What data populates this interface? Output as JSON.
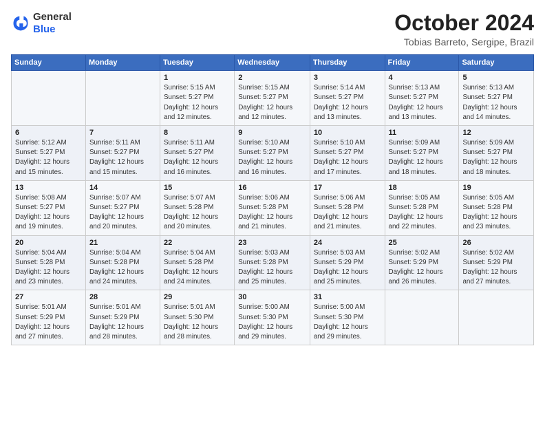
{
  "header": {
    "logo_general": "General",
    "logo_blue": "Blue",
    "month_title": "October 2024",
    "location": "Tobias Barreto, Sergipe, Brazil"
  },
  "weekdays": [
    "Sunday",
    "Monday",
    "Tuesday",
    "Wednesday",
    "Thursday",
    "Friday",
    "Saturday"
  ],
  "weeks": [
    [
      {
        "day": "",
        "info": ""
      },
      {
        "day": "",
        "info": ""
      },
      {
        "day": "1",
        "info": "Sunrise: 5:15 AM\nSunset: 5:27 PM\nDaylight: 12 hours\nand 12 minutes."
      },
      {
        "day": "2",
        "info": "Sunrise: 5:15 AM\nSunset: 5:27 PM\nDaylight: 12 hours\nand 12 minutes."
      },
      {
        "day": "3",
        "info": "Sunrise: 5:14 AM\nSunset: 5:27 PM\nDaylight: 12 hours\nand 13 minutes."
      },
      {
        "day": "4",
        "info": "Sunrise: 5:13 AM\nSunset: 5:27 PM\nDaylight: 12 hours\nand 13 minutes."
      },
      {
        "day": "5",
        "info": "Sunrise: 5:13 AM\nSunset: 5:27 PM\nDaylight: 12 hours\nand 14 minutes."
      }
    ],
    [
      {
        "day": "6",
        "info": "Sunrise: 5:12 AM\nSunset: 5:27 PM\nDaylight: 12 hours\nand 15 minutes."
      },
      {
        "day": "7",
        "info": "Sunrise: 5:11 AM\nSunset: 5:27 PM\nDaylight: 12 hours\nand 15 minutes."
      },
      {
        "day": "8",
        "info": "Sunrise: 5:11 AM\nSunset: 5:27 PM\nDaylight: 12 hours\nand 16 minutes."
      },
      {
        "day": "9",
        "info": "Sunrise: 5:10 AM\nSunset: 5:27 PM\nDaylight: 12 hours\nand 16 minutes."
      },
      {
        "day": "10",
        "info": "Sunrise: 5:10 AM\nSunset: 5:27 PM\nDaylight: 12 hours\nand 17 minutes."
      },
      {
        "day": "11",
        "info": "Sunrise: 5:09 AM\nSunset: 5:27 PM\nDaylight: 12 hours\nand 18 minutes."
      },
      {
        "day": "12",
        "info": "Sunrise: 5:09 AM\nSunset: 5:27 PM\nDaylight: 12 hours\nand 18 minutes."
      }
    ],
    [
      {
        "day": "13",
        "info": "Sunrise: 5:08 AM\nSunset: 5:27 PM\nDaylight: 12 hours\nand 19 minutes."
      },
      {
        "day": "14",
        "info": "Sunrise: 5:07 AM\nSunset: 5:27 PM\nDaylight: 12 hours\nand 20 minutes."
      },
      {
        "day": "15",
        "info": "Sunrise: 5:07 AM\nSunset: 5:28 PM\nDaylight: 12 hours\nand 20 minutes."
      },
      {
        "day": "16",
        "info": "Sunrise: 5:06 AM\nSunset: 5:28 PM\nDaylight: 12 hours\nand 21 minutes."
      },
      {
        "day": "17",
        "info": "Sunrise: 5:06 AM\nSunset: 5:28 PM\nDaylight: 12 hours\nand 21 minutes."
      },
      {
        "day": "18",
        "info": "Sunrise: 5:05 AM\nSunset: 5:28 PM\nDaylight: 12 hours\nand 22 minutes."
      },
      {
        "day": "19",
        "info": "Sunrise: 5:05 AM\nSunset: 5:28 PM\nDaylight: 12 hours\nand 23 minutes."
      }
    ],
    [
      {
        "day": "20",
        "info": "Sunrise: 5:04 AM\nSunset: 5:28 PM\nDaylight: 12 hours\nand 23 minutes."
      },
      {
        "day": "21",
        "info": "Sunrise: 5:04 AM\nSunset: 5:28 PM\nDaylight: 12 hours\nand 24 minutes."
      },
      {
        "day": "22",
        "info": "Sunrise: 5:04 AM\nSunset: 5:28 PM\nDaylight: 12 hours\nand 24 minutes."
      },
      {
        "day": "23",
        "info": "Sunrise: 5:03 AM\nSunset: 5:28 PM\nDaylight: 12 hours\nand 25 minutes."
      },
      {
        "day": "24",
        "info": "Sunrise: 5:03 AM\nSunset: 5:29 PM\nDaylight: 12 hours\nand 25 minutes."
      },
      {
        "day": "25",
        "info": "Sunrise: 5:02 AM\nSunset: 5:29 PM\nDaylight: 12 hours\nand 26 minutes."
      },
      {
        "day": "26",
        "info": "Sunrise: 5:02 AM\nSunset: 5:29 PM\nDaylight: 12 hours\nand 27 minutes."
      }
    ],
    [
      {
        "day": "27",
        "info": "Sunrise: 5:01 AM\nSunset: 5:29 PM\nDaylight: 12 hours\nand 27 minutes."
      },
      {
        "day": "28",
        "info": "Sunrise: 5:01 AM\nSunset: 5:29 PM\nDaylight: 12 hours\nand 28 minutes."
      },
      {
        "day": "29",
        "info": "Sunrise: 5:01 AM\nSunset: 5:30 PM\nDaylight: 12 hours\nand 28 minutes."
      },
      {
        "day": "30",
        "info": "Sunrise: 5:00 AM\nSunset: 5:30 PM\nDaylight: 12 hours\nand 29 minutes."
      },
      {
        "day": "31",
        "info": "Sunrise: 5:00 AM\nSunset: 5:30 PM\nDaylight: 12 hours\nand 29 minutes."
      },
      {
        "day": "",
        "info": ""
      },
      {
        "day": "",
        "info": ""
      }
    ]
  ]
}
